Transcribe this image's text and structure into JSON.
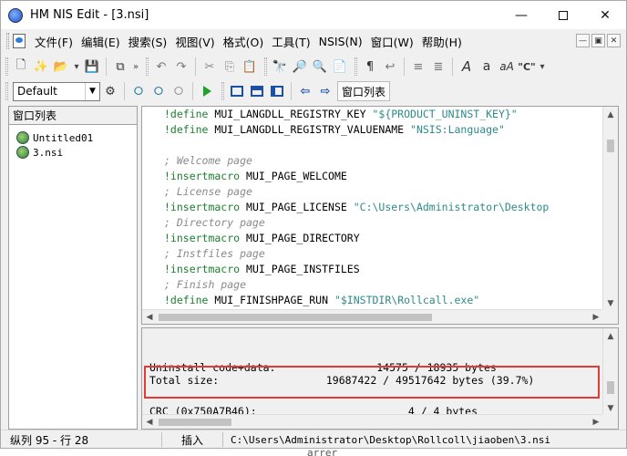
{
  "window": {
    "title": "HM NIS Edit - [3.nsi]"
  },
  "menu": [
    "文件(F)",
    "编辑(E)",
    "搜索(S)",
    "视图(V)",
    "格式(O)",
    "工具(T)",
    "NSIS(N)",
    "窗口(W)",
    "帮助(H)"
  ],
  "toolbar": {
    "profile_value": "Default",
    "window_list_label": "窗口列表"
  },
  "left_panel": {
    "title": "窗口列表",
    "files": [
      "Untitled01",
      "3.nsi"
    ]
  },
  "editor": {
    "lines": [
      [
        {
          "t": "!define",
          "c": "def"
        },
        {
          "t": " MUI_LANGDLL_REGISTRY_KEY ",
          "c": "key"
        },
        {
          "t": "\"${PRODUCT_UNINST_KEY}\"",
          "c": "str"
        }
      ],
      [
        {
          "t": "!define",
          "c": "def"
        },
        {
          "t": " MUI_LANGDLL_REGISTRY_VALUENAME ",
          "c": "key"
        },
        {
          "t": "\"NSIS:Language\"",
          "c": "str"
        }
      ],
      [],
      [
        {
          "t": "; Welcome page",
          "c": "com"
        }
      ],
      [
        {
          "t": "!insertmacro",
          "c": "def"
        },
        {
          "t": " MUI_PAGE_WELCOME",
          "c": "key"
        }
      ],
      [
        {
          "t": "; License page",
          "c": "com"
        }
      ],
      [
        {
          "t": "!insertmacro",
          "c": "def"
        },
        {
          "t": " MUI_PAGE_LICENSE ",
          "c": "key"
        },
        {
          "t": "\"C:\\Users\\Administrator\\Desktop",
          "c": "str"
        }
      ],
      [
        {
          "t": "; Directory page",
          "c": "com"
        }
      ],
      [
        {
          "t": "!insertmacro",
          "c": "def"
        },
        {
          "t": " MUI_PAGE_DIRECTORY",
          "c": "key"
        }
      ],
      [
        {
          "t": "; Instfiles page",
          "c": "com"
        }
      ],
      [
        {
          "t": "!insertmacro",
          "c": "def"
        },
        {
          "t": " MUI_PAGE_INSTFILES",
          "c": "key"
        }
      ],
      [
        {
          "t": "; Finish page",
          "c": "com"
        }
      ],
      [
        {
          "t": "!define",
          "c": "def"
        },
        {
          "t": " MUI_FINISHPAGE_RUN ",
          "c": "key"
        },
        {
          "t": "\"$INSTDIR\\Rollcall.exe\"",
          "c": "str"
        }
      ]
    ]
  },
  "output": {
    "uninstall_line": "Uninstall code+data:                14575 / 18935 bytes",
    "crc_line": "CRC (0x750A7B46):                        4 / 4 bytes",
    "total_line": "Total size:                 19687422 / 49517642 bytes (39.7%)"
  },
  "status": {
    "position": "纵列 95 - 行 28",
    "mode": "插入",
    "path": "C:\\Users\\Administrator\\Desktop\\Rollcoll\\jiaoben\\3.nsi"
  },
  "below_window_text": "arrer"
}
